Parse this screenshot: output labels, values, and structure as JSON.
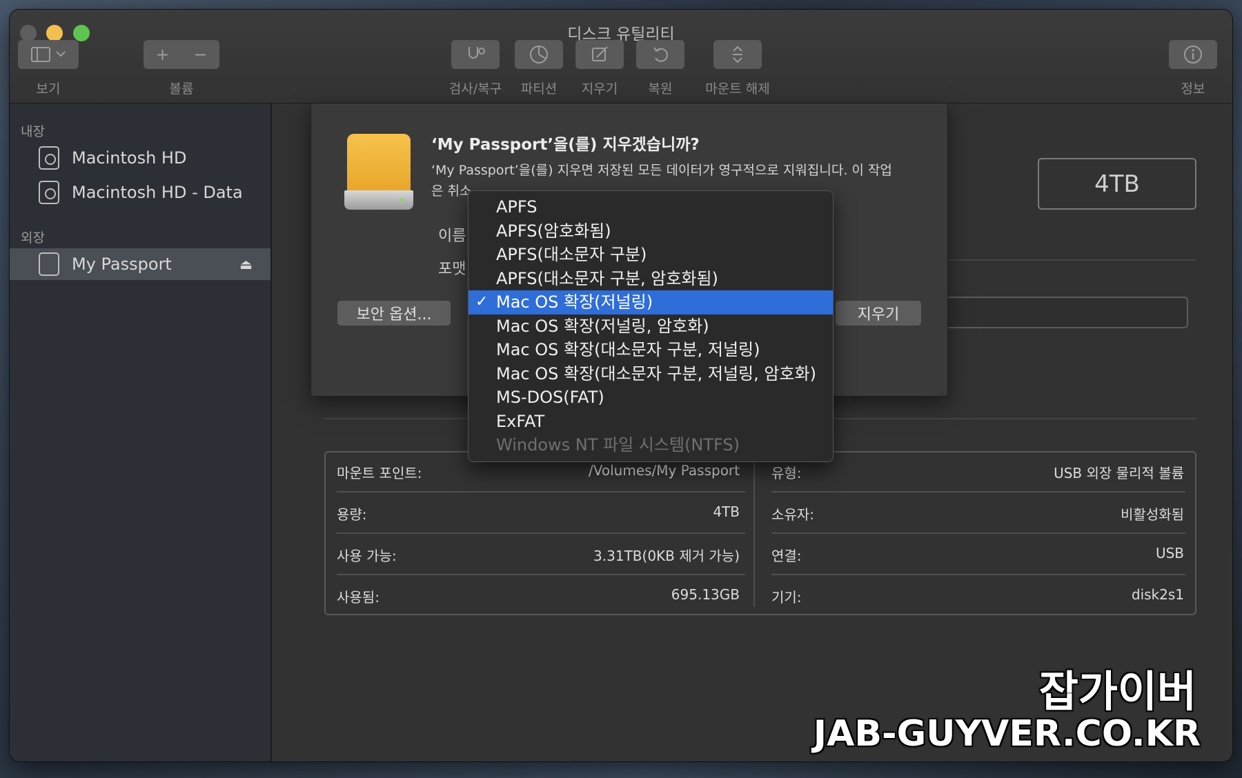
{
  "window": {
    "title": "디스크 유틸리티"
  },
  "toolbar": {
    "view_label": "보기",
    "volume_label": "볼륨",
    "firstaid_label": "검사/복구",
    "partition_label": "파티션",
    "erase_label": "지우기",
    "restore_label": "복원",
    "unmount_label": "마운트 해제",
    "info_label": "정보"
  },
  "sidebar": {
    "internal_header": "내장",
    "external_header": "외장",
    "internal_items": [
      {
        "label": "Macintosh HD"
      },
      {
        "label": "Macintosh HD - Data"
      }
    ],
    "external_items": [
      {
        "label": "My Passport",
        "eject": "⏏"
      }
    ]
  },
  "main": {
    "capacity": "4TB",
    "info": {
      "mount_point_label": "마운트 포인트:",
      "mount_point_value": "/Volumes/My Passport",
      "capacity_label": "용량:",
      "capacity_value": "4TB",
      "available_label": "사용 가능:",
      "available_value": "3.31TB(0KB 제거 가능)",
      "used_label": "사용됨:",
      "used_value": "695.13GB",
      "type_label": "유형:",
      "type_value": "USB 외장 물리적 볼륨",
      "owners_label": "소유자:",
      "owners_value": "비활성화됨",
      "connection_label": "연결:",
      "connection_value": "USB",
      "device_label": "기기:",
      "device_value": "disk2s1"
    }
  },
  "sheet": {
    "title": "‘My Passport’을(를) 지우겠습니까?",
    "desc_line1": "‘My Passport’을(를) 지우면 저장된 모든 데이터가 영구적으로 지워집니다. 이 작업",
    "desc_line2": "은 취소",
    "name_label": "이름",
    "format_label": "포맷",
    "security_button": "보안 옵션...",
    "erase_button": "지우기"
  },
  "format_dropdown": {
    "check_mark": "✓",
    "options": [
      {
        "label": "APFS",
        "selected": false,
        "disabled": false
      },
      {
        "label": "APFS(암호화됨)",
        "selected": false,
        "disabled": false
      },
      {
        "label": "APFS(대소문자 구분)",
        "selected": false,
        "disabled": false
      },
      {
        "label": "APFS(대소문자 구분, 암호화됨)",
        "selected": false,
        "disabled": false
      },
      {
        "label": "Mac OS 확장(저널링)",
        "selected": true,
        "disabled": false
      },
      {
        "label": "Mac OS 확장(저널링, 암호화)",
        "selected": false,
        "disabled": false
      },
      {
        "label": "Mac OS 확장(대소문자 구분, 저널링)",
        "selected": false,
        "disabled": false
      },
      {
        "label": "Mac OS 확장(대소문자 구분, 저널링, 암호화)",
        "selected": false,
        "disabled": false
      },
      {
        "label": "MS-DOS(FAT)",
        "selected": false,
        "disabled": false
      },
      {
        "label": "ExFAT",
        "selected": false,
        "disabled": false
      },
      {
        "label": "Windows NT 파일 시스템(NTFS)",
        "selected": false,
        "disabled": true
      }
    ]
  },
  "watermark": {
    "korean": "잡가이버",
    "domain": "JAB-GUYVER.CO.KR"
  }
}
